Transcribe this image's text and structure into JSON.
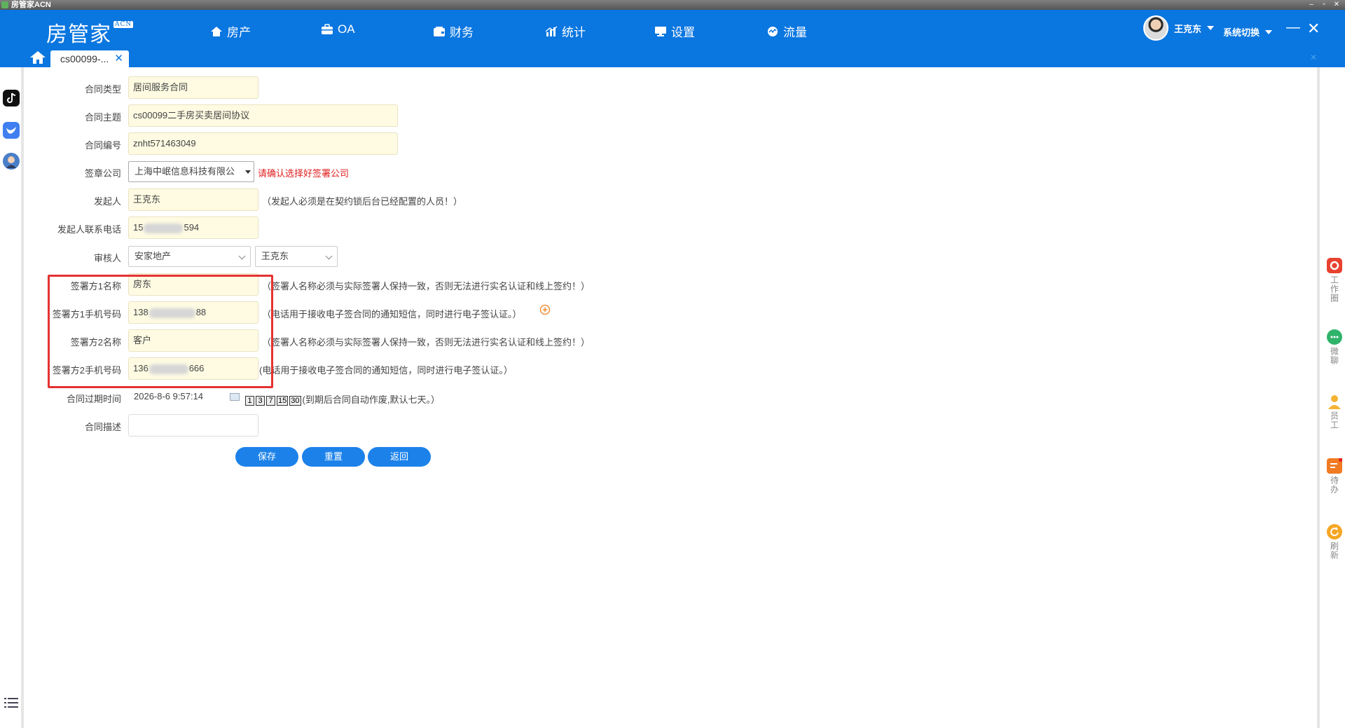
{
  "window": {
    "title": "房管家ACN"
  },
  "brand": {
    "name": "房管家",
    "badge": "ACN"
  },
  "nav": [
    {
      "label": "房产",
      "icon": "house-icon"
    },
    {
      "label": "OA",
      "icon": "briefcase-icon"
    },
    {
      "label": "财务",
      "icon": "wallet-icon"
    },
    {
      "label": "统计",
      "icon": "bar-chart-icon"
    },
    {
      "label": "设置",
      "icon": "monitor-icon"
    },
    {
      "label": "流量",
      "icon": "traffic-icon"
    }
  ],
  "user": {
    "name": "王克东",
    "system_switch": "系统切换"
  },
  "tab": {
    "label": "cs00099-..."
  },
  "form": {
    "contract_type": {
      "label": "合同类型",
      "value": "居间服务合同"
    },
    "contract_subject": {
      "label": "合同主题",
      "value": "cs00099二手房买卖居间协议"
    },
    "contract_number": {
      "label": "合同编号",
      "value": "znht571463049"
    },
    "seal_company": {
      "label": "签章公司",
      "value": "上海中岷信息科技有限公",
      "note": "请确认选择好签署公司"
    },
    "initiator": {
      "label": "发起人",
      "value": "王克东",
      "note": "（发起人必须是在契约锁后台已经配置的人员！）"
    },
    "initiator_phone": {
      "label": "发起人联系电话",
      "prefix": "15",
      "suffix": "594"
    },
    "reviewer": {
      "label": "审核人",
      "dept": "安家地产",
      "person": "王克东"
    },
    "signer1_name": {
      "label": "签署方1名称",
      "value": "房东",
      "note": "（签署人名称必须与实际签署人保持一致，否则无法进行实名认证和线上签约！）"
    },
    "signer1_phone": {
      "label": "签署方1手机号码",
      "prefix": "138",
      "suffix": "88",
      "note": "（电话用于接收电子签合同的通知短信，同时进行电子签认证。）"
    },
    "signer2_name": {
      "label": "签署方2名称",
      "value": "客户",
      "note": "（签署人名称必须与实际签署人保持一致，否则无法进行实名认证和线上签约！）"
    },
    "signer2_phone": {
      "label": "签署方2手机号码",
      "prefix": "136",
      "suffix": "666",
      "note": "(电话用于接收电子签合同的通知短信，同时进行电子签认证。）"
    },
    "expiry": {
      "label": "合同过期时间",
      "value": "2026-8-6 9:57:14",
      "days": [
        "1",
        "3",
        "7",
        "15",
        "30"
      ],
      "note": "(到期后合同自动作废,默认七天。）"
    },
    "description": {
      "label": "合同描述",
      "value": ""
    }
  },
  "buttons": {
    "save": "保存",
    "reset": "重置",
    "back": "返回"
  },
  "right_rail": [
    {
      "label": "工作圈",
      "color": "#e8412f"
    },
    {
      "label": "微聊",
      "color": "#2fb36a"
    },
    {
      "label": "员工",
      "color": "#f5b335"
    },
    {
      "label": "待办",
      "color": "#f07a22"
    },
    {
      "label": "刷新",
      "color": "#f5a623"
    }
  ],
  "colors": {
    "nav_bg": "#0a76e0",
    "input_bg": "#fefbe2",
    "highlight": "#e43232",
    "button": "#1c82ea"
  }
}
